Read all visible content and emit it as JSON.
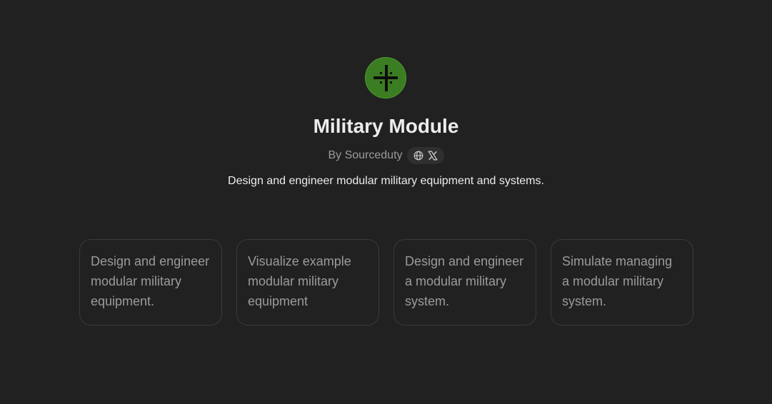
{
  "gpt": {
    "logo_icon": "crosshair-plus-icon",
    "logo_color": "#3a7d22",
    "title": "Military Module",
    "byline": "By Sourceduty",
    "social_icons": [
      "globe-icon",
      "x-logo-icon"
    ],
    "description": "Design and engineer modular military equipment and systems."
  },
  "starters": [
    {
      "text": "Design and engineer modular military equipment."
    },
    {
      "text": "Visualize example modular military equipment"
    },
    {
      "text": "Design and engineer a modular military system."
    },
    {
      "text": "Simulate managing a modular military system."
    }
  ]
}
